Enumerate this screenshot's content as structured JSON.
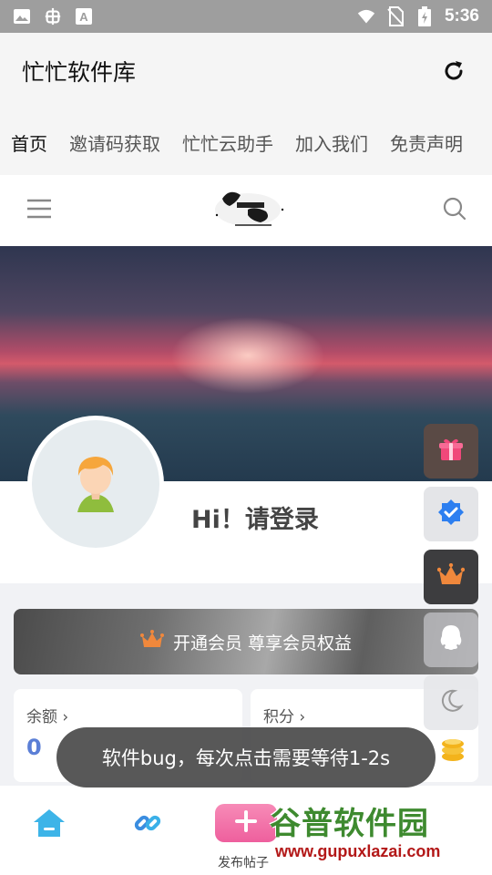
{
  "status_bar": {
    "time": "5:36",
    "icons": [
      "image-icon",
      "bug-icon",
      "font-icon",
      "wifi-icon",
      "no-sim-icon",
      "battery-charging-icon"
    ]
  },
  "app_bar": {
    "title": "忙忙软件库",
    "refresh_icon": "refresh-icon"
  },
  "tabs": [
    {
      "label": "首页",
      "active": true
    },
    {
      "label": "邀请码获取",
      "active": false
    },
    {
      "label": "忙忙云助手",
      "active": false
    },
    {
      "label": "加入我们",
      "active": false
    },
    {
      "label": "免责声明",
      "active": false
    }
  ],
  "site_header": {
    "menu_icon": "menu-icon",
    "search_icon": "search-icon",
    "logo_icon": "site-logo"
  },
  "profile": {
    "greeting": "Hi！请登录"
  },
  "vip": {
    "label": "开通会员 尊享会员权益",
    "icon": "crown-icon"
  },
  "stats": [
    {
      "label": "余额",
      "value": "0"
    },
    {
      "label": "积分",
      "value": ""
    }
  ],
  "float_buttons": [
    "gift-icon",
    "verified-icon",
    "crown-icon",
    "qq-icon",
    "moon-icon"
  ],
  "bottom_nav": {
    "items": [
      "home-icon",
      "link-icon"
    ],
    "post_label": "发布帖子"
  },
  "toast": {
    "text": "软件bug，每次点击需要等待1-2s"
  },
  "watermark": {
    "name": "谷普软件园",
    "url": "www.gupuxlazai.com"
  },
  "colors": {
    "accent_blue": "#5b7fd6",
    "vip_crown": "#f0883c",
    "post_pink": "#ee5f9d"
  }
}
